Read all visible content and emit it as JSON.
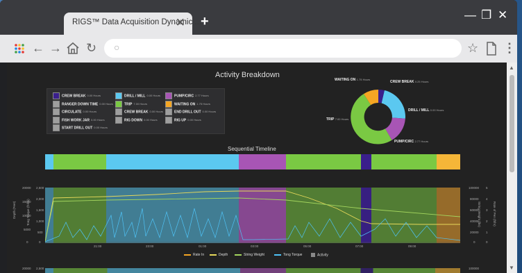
{
  "browser": {
    "tab_title": "RIGS™ Data Acquisition Dynamic ...",
    "tab_close": "✕",
    "new_tab": "+",
    "minimize": "—",
    "restore": "❐",
    "close": "✕"
  },
  "colors": {
    "crew_break": "#3a1f8c",
    "ranger_down_time": "#9e9e9e",
    "circulate": "#9e9e9e",
    "fish_work_jar": "#9e9e9e",
    "start_drill_out": "#9e9e9e",
    "drill_mill": "#5bc8f0",
    "trip": "#7ac943",
    "crew_break2": "#9e9e9e",
    "rig_down": "#9e9e9e",
    "pump_circ": "#a855b5",
    "waiting_on": "#f5a623",
    "end_drill_out": "#9e9e9e",
    "rig_up": "#9e9e9e"
  },
  "page": {
    "title": "Activity Breakdown",
    "sequential_title": "Sequential Timeline"
  },
  "legend": [
    {
      "label": "CREW BREAK",
      "hrs": "0.00 Hours",
      "color": "#3a1f8c"
    },
    {
      "label": "RANGER DOWN TIME",
      "hrs": "0.00 Hours",
      "color": "#9e9e9e"
    },
    {
      "label": "CIRCULATE",
      "hrs": "0.00 Hours",
      "color": "#9e9e9e"
    },
    {
      "label": "FISH WORK JAR",
      "hrs": "0.00 Hours",
      "color": "#9e9e9e"
    },
    {
      "label": "START DRILL OUT",
      "hrs": "0.00 Hours",
      "color": "#9e9e9e"
    },
    {
      "label": "DRILL / MILL",
      "hrs": "0.00 Hours",
      "color": "#5bc8f0"
    },
    {
      "label": "TRIP",
      "hrs": "7.00 Hours",
      "color": "#7ac943"
    },
    {
      "label": "CREW BREAK",
      "hrs": "0.00 Hours",
      "color": "#9e9e9e"
    },
    {
      "label": "RIG DOWN",
      "hrs": "0.00 Hours",
      "color": "#9e9e9e"
    },
    {
      "label": "PUMP/CIRC",
      "hrs": "2.77 Hours",
      "color": "#a855b5"
    },
    {
      "label": "WAITING ON",
      "hrs": "1.75 Hours",
      "color": "#f5a623"
    },
    {
      "label": "END DRILL OUT",
      "hrs": "0.00 Hours",
      "color": "#9e9e9e"
    },
    {
      "label": "RIG UP",
      "hrs": "0.00 Hours",
      "color": "#9e9e9e"
    }
  ],
  "donut_labels": {
    "waiting_on": "WAITING ON",
    "waiting_on_hrs": "1.75 Hours",
    "crew_break": "CREW BREAK",
    "crew_break_hrs": "0.25 Hours",
    "drill_mill": "DRILL / MILL",
    "drill_mill_hrs": "0.00 Hours",
    "trip": "TRIP",
    "trip_hrs": "7.00 Hours",
    "pump_circ": "PUMP/CIRC",
    "pump_circ_hrs": "2.77 Hours"
  },
  "chart_data": {
    "type": "line",
    "left_axis_depth": [
      "20000",
      "15000",
      "10000",
      "5000",
      "0"
    ],
    "left_axis_hook": [
      "2,500",
      "2,000",
      "1,500",
      "1,000",
      "500",
      "0"
    ],
    "left_axis_label_1": "Depth (Feet)",
    "left_axis_label_2": "Tong Torque (ft-lbs)",
    "x_ticks": [
      "21:00",
      "23:00",
      "01:00",
      "03:00",
      "05:00",
      "07:00",
      "09:00"
    ],
    "right_axis_1": [
      "100000",
      "80000",
      "60000",
      "40000",
      "20000",
      "0"
    ],
    "right_axis_2": [
      "5",
      "4",
      "3",
      "2",
      "1",
      "0"
    ],
    "right_axis_label_1": "String Weight (lbs)",
    "right_axis_label_2": "Rate of Pen (ft/hr)",
    "series": [
      "Rate In",
      "Depth",
      "String Weight",
      "Tong Torque",
      "Activity"
    ],
    "bottom_left_tick": "20000",
    "bottom_left_tick_2": "2,500",
    "bottom_right_tick": "100000"
  }
}
